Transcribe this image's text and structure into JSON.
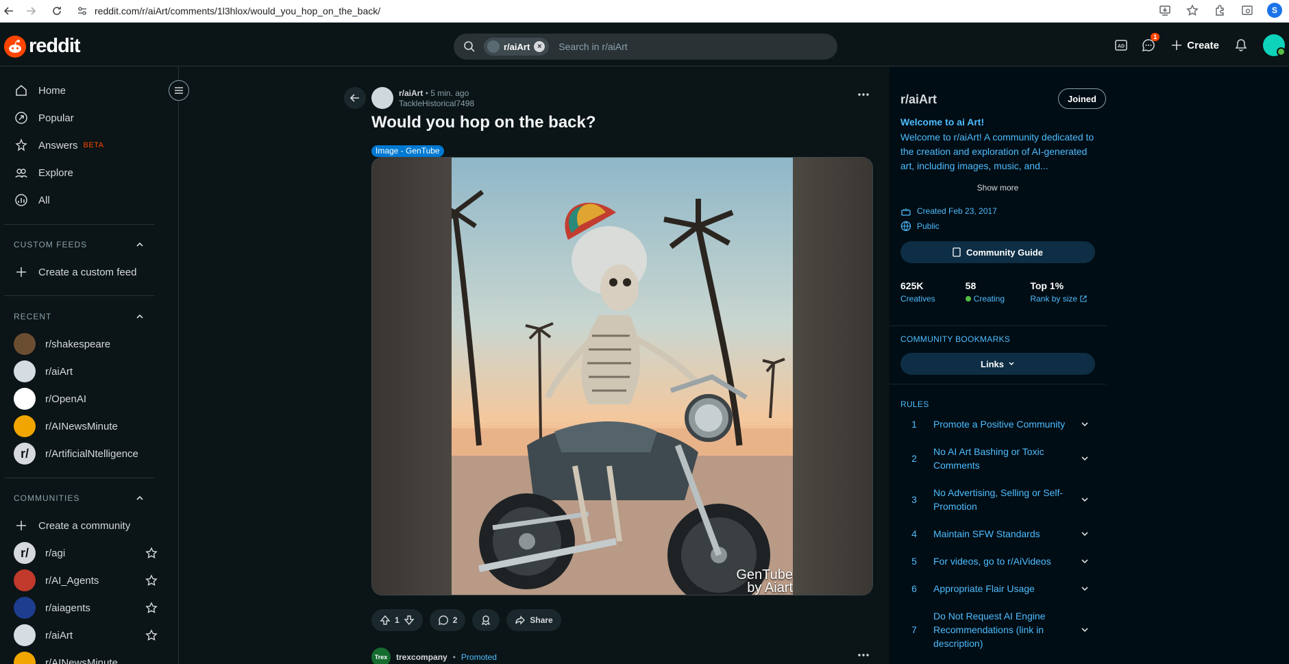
{
  "browser": {
    "url": "reddit.com/r/aiArt/comments/1l3hlox/would_you_hop_on_the_back/",
    "profile_initial": "S"
  },
  "header": {
    "logo_text": "reddit",
    "search_chip": "r/aiArt",
    "search_placeholder": "Search in r/aiArt",
    "chat_badge": "1",
    "create_label": "Create",
    "brand_color": "#ff4500"
  },
  "left_nav": {
    "main": [
      {
        "label": "Home",
        "icon": "home-icon"
      },
      {
        "label": "Popular",
        "icon": "popular-icon"
      },
      {
        "label": "Answers",
        "icon": "answers-icon",
        "badge": "BETA"
      },
      {
        "label": "Explore",
        "icon": "explore-icon"
      },
      {
        "label": "All",
        "icon": "all-icon"
      }
    ],
    "custom_feeds": {
      "heading": "CUSTOM FEEDS",
      "create": "Create a custom feed"
    },
    "recent": {
      "heading": "RECENT",
      "items": [
        "r/shakespeare",
        "r/aiArt",
        "r/OpenAI",
        "r/AINewsMinute",
        "r/ArtificialNtelligence"
      ]
    },
    "communities": {
      "heading": "COMMUNITIES",
      "create": "Create a community",
      "items": [
        "r/agi",
        "r/AI_Agents",
        "r/aiagents",
        "r/aiArt",
        "r/AINewsMinute"
      ]
    }
  },
  "post": {
    "subreddit": "r/aiArt",
    "time": "• 5 min. ago",
    "author": "TackleHistorical7498",
    "title": "Would you hop on the back?",
    "flair": "Image - GenTube",
    "watermark_line1": "GenTube",
    "watermark_line2": "by Aiart",
    "upvotes": "1",
    "comments": "2",
    "share_label": "Share",
    "promoted": {
      "name": "trexcompany",
      "tag": "Promoted",
      "avatar_text": "Trex"
    }
  },
  "sidebar": {
    "title": "r/aiArt",
    "joined_label": "Joined",
    "welcome": "Welcome to ai Art!",
    "description": "Welcome to r/aiArt! A community dedicated to the creation and exploration of AI-generated art, including images, music, and...",
    "show_more": "Show more",
    "created": "Created Feb 23, 2017",
    "visibility": "Public",
    "guide_label": "Community Guide",
    "stats": [
      {
        "value": "625K",
        "label": "Creatives"
      },
      {
        "value": "58",
        "label": "Creating"
      },
      {
        "value": "Top 1%",
        "label": "Rank by size"
      }
    ],
    "bookmarks_heading": "COMMUNITY BOOKMARKS",
    "links_label": "Links",
    "rules_heading": "RULES",
    "rules": [
      {
        "n": "1",
        "text": "Promote a Positive Community"
      },
      {
        "n": "2",
        "text": "No AI Art Bashing or Toxic Comments"
      },
      {
        "n": "3",
        "text": "No Advertising, Selling or Self-Promotion"
      },
      {
        "n": "4",
        "text": "Maintain SFW Standards"
      },
      {
        "n": "5",
        "text": "For videos, go to r/AiVideos"
      },
      {
        "n": "6",
        "text": "Appropriate Flair Usage"
      },
      {
        "n": "7",
        "text": "Do Not Request AI Engine Recommendations (link in description)"
      }
    ]
  }
}
